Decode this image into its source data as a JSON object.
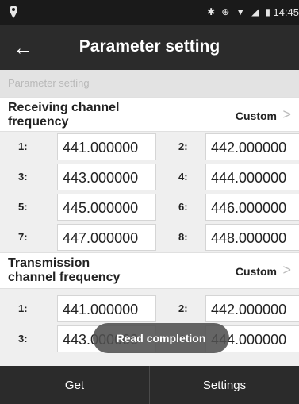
{
  "status_bar": {
    "time": "14:45",
    "icons": [
      "bluetooth-icon",
      "sync-icon",
      "wifi-icon",
      "signal-icon",
      "battery-icon"
    ]
  },
  "app_bar": {
    "back_glyph": "←",
    "title": "Parameter setting"
  },
  "section_header": "Parameter setting",
  "receiving": {
    "label_line1": "Receiving channel",
    "label_line2": "frequency",
    "value": "Custom",
    "channels": [
      {
        "num": "1:",
        "freq": "441.000000"
      },
      {
        "num": "2:",
        "freq": "442.000000"
      },
      {
        "num": "3:",
        "freq": "443.000000"
      },
      {
        "num": "4:",
        "freq": "444.000000"
      },
      {
        "num": "5:",
        "freq": "445.000000"
      },
      {
        "num": "6:",
        "freq": "446.000000"
      },
      {
        "num": "7:",
        "freq": "447.000000"
      },
      {
        "num": "8:",
        "freq": "448.000000"
      }
    ]
  },
  "transmission": {
    "label_line1": "Transmission",
    "label_line2": "channel frequency",
    "value": "Custom",
    "channels": [
      {
        "num": "1:",
        "freq": "441.000000"
      },
      {
        "num": "2:",
        "freq": "442.000000"
      },
      {
        "num": "3:",
        "freq": "443.000000"
      },
      {
        "num": "4:",
        "freq": "444.000000"
      }
    ]
  },
  "toast": "Read completion",
  "bottom_bar": {
    "get_label": "Get",
    "settings_label": "Settings"
  }
}
